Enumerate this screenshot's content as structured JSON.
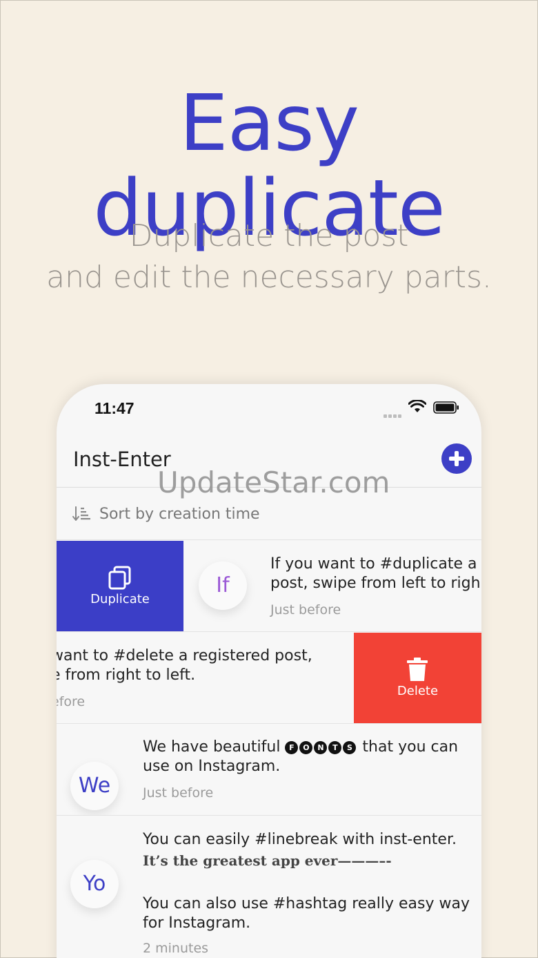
{
  "hero": {
    "title": "Easy duplicate",
    "subtitle_line1": "Duplicate the post",
    "subtitle_line2": "and edit the necessary parts."
  },
  "status_bar": {
    "time": "11:47"
  },
  "nav": {
    "title": "Inst-Enter",
    "add_icon": "plus-circle-icon"
  },
  "watermark": "UpdateStar.com",
  "sort": {
    "label": "Sort by creation time",
    "icon": "sort-descending-icon"
  },
  "actions": {
    "duplicate_label": "Duplicate",
    "delete_label": "Delete"
  },
  "posts": [
    {
      "avatar": "If",
      "line1": "If you want to #duplicate a r",
      "line2": "post, swipe from left to righ",
      "time": "Just before"
    },
    {
      "line1": " want to #delete a registered post,",
      "line2": "e from right to left.",
      "time": "efore"
    },
    {
      "avatar": "We",
      "line1_a": "We have beautiful ",
      "fonts_letters": [
        "F",
        "O",
        "N",
        "T",
        "S"
      ],
      "line1_b": " that you can",
      "line2": "use on Instagram.",
      "time": "Just before"
    },
    {
      "avatar": "Yo",
      "line1": "You can easily #linebreak with inst-enter.",
      "line2": "It’s the greatest app ever———–-",
      "line3": "You can also use #hashtag really easy way",
      "line4": "for Instagram.",
      "time": "2 minutes"
    }
  ],
  "colors": {
    "background": "#f6efe3",
    "accent": "#3d3fc6",
    "delete": "#f24236",
    "subtitle": "#9a958f"
  }
}
